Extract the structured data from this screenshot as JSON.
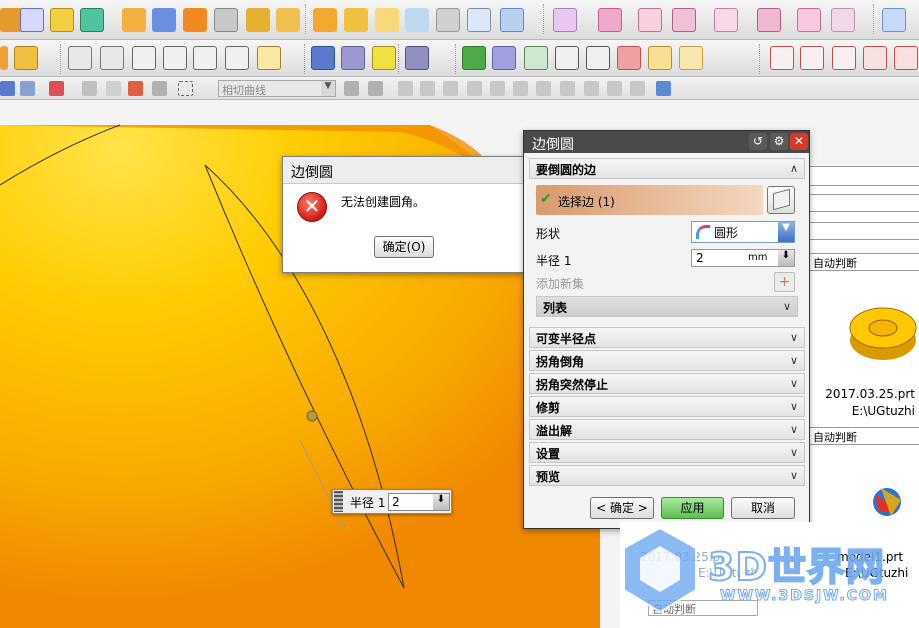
{
  "toolbar": {
    "row3_combo": "相切曲线"
  },
  "right_panel": {
    "rows": [
      "自动判断",
      "自动判断"
    ],
    "file1_name": "2017.03.25.prt",
    "file1_path": "E:\\UGtuzhi",
    "file2_name": "2017.03.25.prt",
    "file2_path": "E:\\UGtuzhi",
    "file3_name": "model1.prt",
    "file3_path": "E:\\UGtuzhi",
    "bottom_row": "自动判断"
  },
  "error_dialog": {
    "title": "边倒圆",
    "message": "无法创建圆角。",
    "ok_label": "确定(O)"
  },
  "main_dialog": {
    "title": "边倒圆",
    "section_edges": "要倒圆的边",
    "select_edge": "选择边 (1)",
    "shape_label": "形状",
    "shape_value": "圆形",
    "radius_label": "半径 1",
    "radius_value": "2",
    "radius_unit": "mm",
    "add_new_set": "添加新集",
    "list_label": "列表",
    "sections": [
      "可变半径点",
      "拐角倒角",
      "拐角突然停止",
      "修剪",
      "溢出解",
      "设置",
      "预览"
    ],
    "ok_label": "< 确定 >",
    "apply_label": "应用",
    "cancel_label": "取消"
  },
  "quick_input": {
    "label": "半径 1",
    "value": "2"
  },
  "watermark": {
    "brand": "3D世界网",
    "url": "WWW.3DSJW.COM"
  },
  "colors": {
    "part_yellow": "#ffcc00",
    "part_orange": "#f59200",
    "title_bar": "#4a4a4a",
    "close_red": "#d43a2a",
    "apply_green": "#7fd07a",
    "selected_row": "#d99a6c"
  }
}
